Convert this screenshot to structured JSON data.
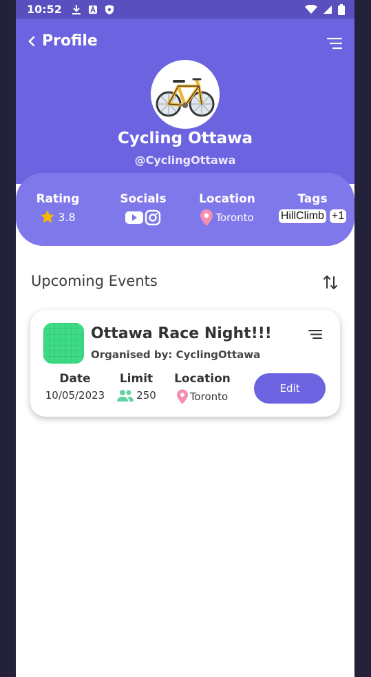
{
  "status_bar": {
    "time": "10:52"
  },
  "header": {
    "back_label": "Profile",
    "org_name": "Cycling Ottawa",
    "handle": "@CyclingOttawa"
  },
  "stats": {
    "rating_label": "Rating",
    "rating_value": "3.8",
    "socials_label": "Socials",
    "location_label": "Location",
    "location_value": "Toronto",
    "tags_label": "Tags",
    "tags": [
      "HillClimb"
    ],
    "tags_more": "+1"
  },
  "events": {
    "section_title": "Upcoming Events",
    "items": [
      {
        "title": "Ottawa Race Night!!!",
        "organiser": "Organised by: CyclingOttawa",
        "date_label": "Date",
        "date": "10/05/2023",
        "limit_label": "Limit",
        "limit": "250",
        "location_label": "Location",
        "location": "Toronto",
        "edit_label": "Edit"
      }
    ]
  },
  "colors": {
    "primary": "#6c63e0",
    "stats_bg": "#7f78eb",
    "thumb": "#3ddc84",
    "star": "#f5b800",
    "pin": "#f48fb1",
    "people": "#5fd4a0"
  }
}
